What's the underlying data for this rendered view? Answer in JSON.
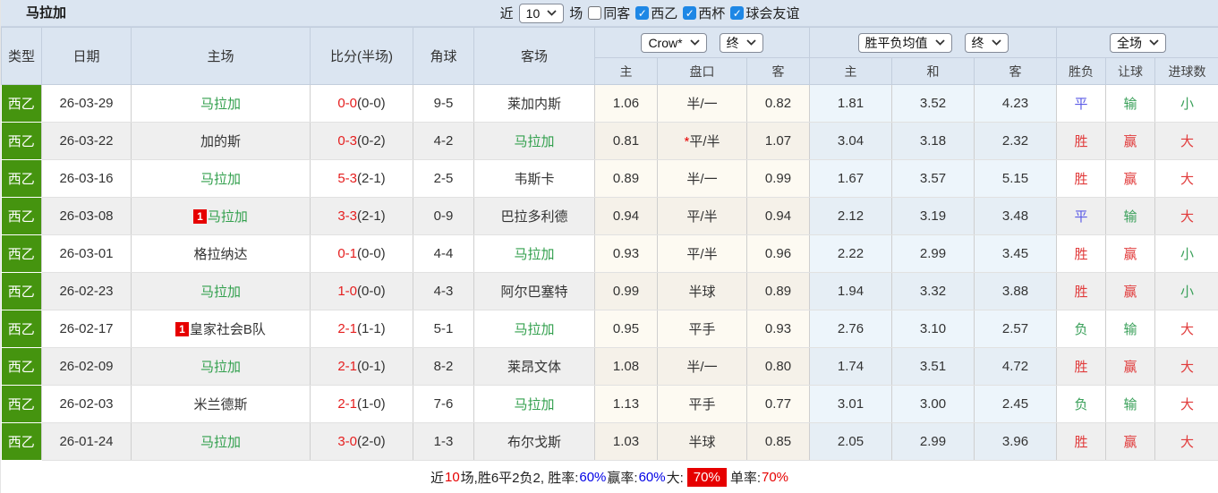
{
  "page": {
    "title": "马拉加",
    "filter": {
      "recent_label": "近",
      "recent_count": "10",
      "recent_suffix": "场",
      "checkboxes": [
        {
          "label": "同客",
          "checked": false
        },
        {
          "label": "西乙",
          "checked": true
        },
        {
          "label": "西杯",
          "checked": true
        },
        {
          "label": "球会友谊",
          "checked": true
        }
      ]
    }
  },
  "table": {
    "columns": [
      "类型",
      "日期",
      "主场",
      "比分(半场)",
      "角球",
      "客场"
    ],
    "selects": {
      "crow_source": "Crow*",
      "crow_time": "终",
      "mean_source": "胜平负均值",
      "mean_time": "终",
      "scope": "全场"
    },
    "subcolumns": [
      "主",
      "盘口",
      "客",
      "主",
      "和",
      "客",
      "胜负",
      "让球",
      "进球数"
    ],
    "rows": [
      {
        "league": "西乙",
        "date": "26-03-29",
        "home": "马拉加",
        "home_target": true,
        "home_card": "",
        "score": "0-0",
        "half": "(0-0)",
        "corners": "9-5",
        "away": "莱加内斯",
        "away_target": false,
        "odds_home": "1.06",
        "handicap_star": "",
        "handicap": "半/一",
        "odds_away": "0.82",
        "mean_home": "1.81",
        "mean_draw": "3.52",
        "mean_away": "4.23",
        "result_wdl": "平",
        "result_wdl_color": "blue",
        "result_handicap": "输",
        "result_handicap_color": "green",
        "result_goals": "小",
        "result_goals_color": "green"
      },
      {
        "league": "西乙",
        "date": "26-03-22",
        "home": "加的斯",
        "home_target": false,
        "home_card": "",
        "score": "0-3",
        "half": "(0-2)",
        "corners": "4-2",
        "away": "马拉加",
        "away_target": true,
        "odds_home": "0.81",
        "handicap_star": "*",
        "handicap": "平/半",
        "odds_away": "1.07",
        "mean_home": "3.04",
        "mean_draw": "3.18",
        "mean_away": "2.32",
        "result_wdl": "胜",
        "result_wdl_color": "red",
        "result_handicap": "赢",
        "result_handicap_color": "red",
        "result_goals": "大",
        "result_goals_color": "red"
      },
      {
        "league": "西乙",
        "date": "26-03-16",
        "home": "马拉加",
        "home_target": true,
        "home_card": "",
        "score": "5-3",
        "half": "(2-1)",
        "corners": "2-5",
        "away": "韦斯卡",
        "away_target": false,
        "odds_home": "0.89",
        "handicap_star": "",
        "handicap": "半/一",
        "odds_away": "0.99",
        "mean_home": "1.67",
        "mean_draw": "3.57",
        "mean_away": "5.15",
        "result_wdl": "胜",
        "result_wdl_color": "red",
        "result_handicap": "赢",
        "result_handicap_color": "red",
        "result_goals": "大",
        "result_goals_color": "red"
      },
      {
        "league": "西乙",
        "date": "26-03-08",
        "home": "马拉加",
        "home_target": true,
        "home_card": "1",
        "score": "3-3",
        "half": "(2-1)",
        "corners": "0-9",
        "away": "巴拉多利德",
        "away_target": false,
        "odds_home": "0.94",
        "handicap_star": "",
        "handicap": "平/半",
        "odds_away": "0.94",
        "mean_home": "2.12",
        "mean_draw": "3.19",
        "mean_away": "3.48",
        "result_wdl": "平",
        "result_wdl_color": "blue",
        "result_handicap": "输",
        "result_handicap_color": "green",
        "result_goals": "大",
        "result_goals_color": "red"
      },
      {
        "league": "西乙",
        "date": "26-03-01",
        "home": "格拉纳达",
        "home_target": false,
        "home_card": "",
        "score": "0-1",
        "half": "(0-0)",
        "corners": "4-4",
        "away": "马拉加",
        "away_target": true,
        "odds_home": "0.93",
        "handicap_star": "",
        "handicap": "平/半",
        "odds_away": "0.96",
        "mean_home": "2.22",
        "mean_draw": "2.99",
        "mean_away": "3.45",
        "result_wdl": "胜",
        "result_wdl_color": "red",
        "result_handicap": "赢",
        "result_handicap_color": "red",
        "result_goals": "小",
        "result_goals_color": "green"
      },
      {
        "league": "西乙",
        "date": "26-02-23",
        "home": "马拉加",
        "home_target": true,
        "home_card": "",
        "score": "1-0",
        "half": "(0-0)",
        "corners": "4-3",
        "away": "阿尔巴塞特",
        "away_target": false,
        "odds_home": "0.99",
        "handicap_star": "",
        "handicap": "半球",
        "odds_away": "0.89",
        "mean_home": "1.94",
        "mean_draw": "3.32",
        "mean_away": "3.88",
        "result_wdl": "胜",
        "result_wdl_color": "red",
        "result_handicap": "赢",
        "result_handicap_color": "red",
        "result_goals": "小",
        "result_goals_color": "green"
      },
      {
        "league": "西乙",
        "date": "26-02-17",
        "home": "皇家社会B队",
        "home_target": false,
        "home_card": "1",
        "score": "2-1",
        "half": "(1-1)",
        "corners": "5-1",
        "away": "马拉加",
        "away_target": true,
        "odds_home": "0.95",
        "handicap_star": "",
        "handicap": "平手",
        "odds_away": "0.93",
        "mean_home": "2.76",
        "mean_draw": "3.10",
        "mean_away": "2.57",
        "result_wdl": "负",
        "result_wdl_color": "green",
        "result_handicap": "输",
        "result_handicap_color": "green",
        "result_goals": "大",
        "result_goals_color": "red"
      },
      {
        "league": "西乙",
        "date": "26-02-09",
        "home": "马拉加",
        "home_target": true,
        "home_card": "",
        "score": "2-1",
        "half": "(0-1)",
        "corners": "8-2",
        "away": "莱昂文体",
        "away_target": false,
        "odds_home": "1.08",
        "handicap_star": "",
        "handicap": "半/一",
        "odds_away": "0.80",
        "mean_home": "1.74",
        "mean_draw": "3.51",
        "mean_away": "4.72",
        "result_wdl": "胜",
        "result_wdl_color": "red",
        "result_handicap": "赢",
        "result_handicap_color": "red",
        "result_goals": "大",
        "result_goals_color": "red"
      },
      {
        "league": "西乙",
        "date": "26-02-03",
        "home": "米兰德斯",
        "home_target": false,
        "home_card": "",
        "score": "2-1",
        "half": "(1-0)",
        "corners": "7-6",
        "away": "马拉加",
        "away_target": true,
        "odds_home": "1.13",
        "handicap_star": "",
        "handicap": "平手",
        "odds_away": "0.77",
        "mean_home": "3.01",
        "mean_draw": "3.00",
        "mean_away": "2.45",
        "result_wdl": "负",
        "result_wdl_color": "green",
        "result_handicap": "输",
        "result_handicap_color": "green",
        "result_goals": "大",
        "result_goals_color": "red"
      },
      {
        "league": "西乙",
        "date": "26-01-24",
        "home": "马拉加",
        "home_target": true,
        "home_card": "",
        "score": "3-0",
        "half": "(2-0)",
        "corners": "1-3",
        "away": "布尔戈斯",
        "away_target": false,
        "odds_home": "1.03",
        "handicap_star": "",
        "handicap": "半球",
        "odds_away": "0.85",
        "mean_home": "2.05",
        "mean_draw": "2.99",
        "mean_away": "3.96",
        "result_wdl": "胜",
        "result_wdl_color": "red",
        "result_handicap": "赢",
        "result_handicap_color": "red",
        "result_goals": "大",
        "result_goals_color": "red"
      }
    ]
  },
  "footer": {
    "prefix": "近",
    "count": "10",
    "summary": "场,胜6平2负2, 胜率:",
    "win_rate": "60%",
    "label_handicap": " 赢率:",
    "handicap_rate": "60%",
    "label_big": " 大:",
    "big_rate": "70%",
    "label_odd": " 单率:",
    "odd_rate": "70%"
  }
}
